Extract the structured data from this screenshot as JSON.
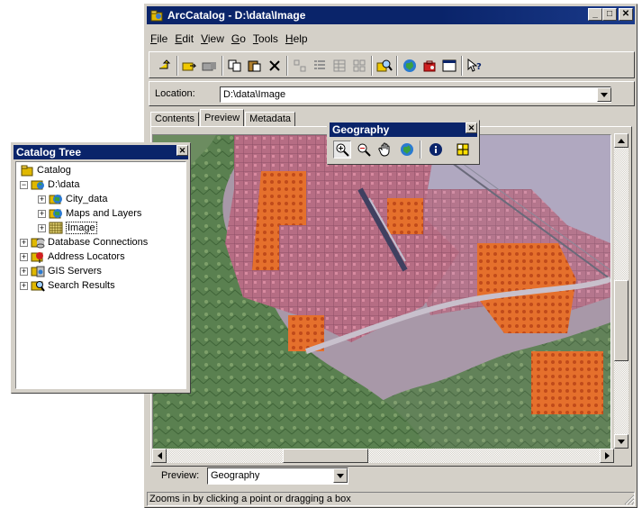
{
  "window": {
    "title": "ArcCatalog - D:\\data\\Image",
    "minimize": "_",
    "maximize": "□",
    "close": "✕"
  },
  "menu": [
    "File",
    "Edit",
    "View",
    "Go",
    "Tools",
    "Help"
  ],
  "menu_underline": [
    "F",
    "E",
    "V",
    "G",
    "T",
    "H"
  ],
  "toolbar_icons": [
    "up-one-level-icon",
    "connect-folder-icon",
    "disconnect-folder-icon",
    "copy-icon",
    "paste-icon",
    "delete-icon",
    "large-icons-icon",
    "list-icon",
    "details-icon",
    "thumbnails-icon",
    "search-icon",
    "launch-arcmap-icon",
    "arctoolbox-icon",
    "command-line-icon",
    "whats-this-icon"
  ],
  "location": {
    "label": "Location:",
    "value": "D:\\data\\Image"
  },
  "tabs": [
    "Contents",
    "Preview",
    "Metadata"
  ],
  "active_tab": "Preview",
  "preview": {
    "label": "Preview:",
    "value": "Geography"
  },
  "status": "Zooms in by clicking a point or dragging a box",
  "geography_toolbar": {
    "title": "Geography",
    "close": "✕",
    "tools": [
      "zoom-in-icon",
      "zoom-out-icon",
      "pan-hand-icon",
      "full-extent-globe-icon",
      "identify-icon",
      "create-thumbnail-icon"
    ]
  },
  "catalog_tree": {
    "title": "Catalog Tree",
    "close": "✕",
    "nodes": [
      {
        "label": "Catalog",
        "level": 0,
        "expander": ""
      },
      {
        "label": "D:\\data",
        "level": 1,
        "expander": "−"
      },
      {
        "label": "City_data",
        "level": 2,
        "expander": "+"
      },
      {
        "label": "Maps and Layers",
        "level": 2,
        "expander": "+"
      },
      {
        "label": "Image",
        "level": 2,
        "expander": "+"
      },
      {
        "label": "Database Connections",
        "level": 1,
        "expander": "+"
      },
      {
        "label": "Address Locators",
        "level": 1,
        "expander": "+"
      },
      {
        "label": "GIS Servers",
        "level": 1,
        "expander": "+"
      },
      {
        "label": "Search Results",
        "level": 1,
        "expander": "+"
      }
    ]
  },
  "colors": {
    "titlebar": "#0a246a",
    "face": "#d4d0c8",
    "urban_orange": "#e8732a",
    "urban_pink": "#c98aa4",
    "vegetation": "#4f7d4a"
  }
}
